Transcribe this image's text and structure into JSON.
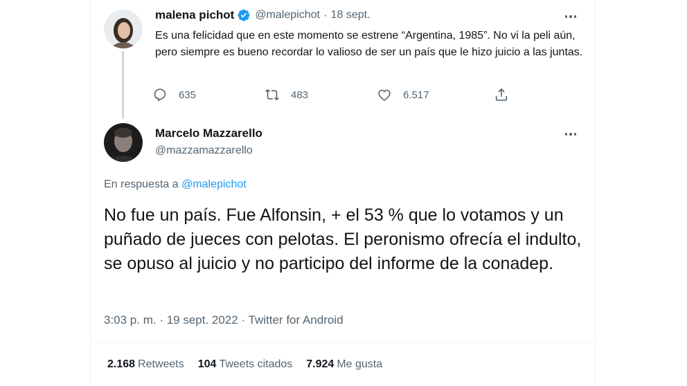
{
  "original_tweet": {
    "author_name": "malena pichot",
    "handle": "@malepichot",
    "separator": "·",
    "date": "18 sept.",
    "text": "Es una felicidad que en este momento se estrene “Argentina, 1985”. No vi la peli aún, pero siempre es bueno recordar lo valioso de ser un país que le hizo juicio a las juntas.",
    "replies": "635",
    "retweets": "483",
    "likes": "6.517",
    "icons": [
      "verified-icon",
      "more-icon",
      "reply-icon",
      "retweet-icon",
      "like-icon",
      "share-icon"
    ]
  },
  "reply_tweet": {
    "author_name": "Marcelo Mazzarello",
    "handle": "@mazzamazzarello",
    "reply_prefix": "En respuesta a",
    "reply_to": "@malepichot",
    "text": "No fue un país. Fue Alfonsin, + el 53 % que lo votamos y un puñado de jueces con pelotas. El peronismo ofrecía el indulto, se opuso al juicio  y no participo del informe de la conadep.",
    "meta": "3:03 p. m. · 19 sept. 2022 · Twitter for Android"
  },
  "stats": {
    "retweets_count": "2.168",
    "retweets_label": "Retweets",
    "quotes_count": "104",
    "quotes_label": "Tweets citados",
    "likes_count": "7.924",
    "likes_label": "Me gusta"
  },
  "colors": {
    "text": "#0f1419",
    "muted": "#536471",
    "accent": "#1d9bf0",
    "thread_line": "#cfd9de"
  }
}
